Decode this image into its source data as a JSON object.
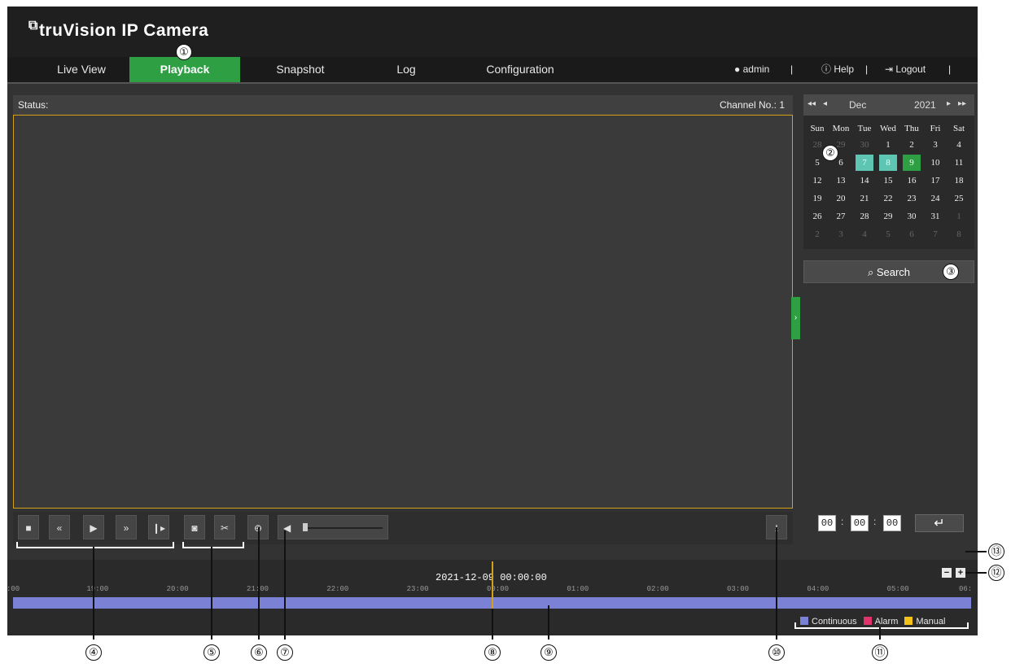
{
  "app": {
    "brand": "truVision",
    "title": "IP Camera",
    "logo_glyph": "⧉"
  },
  "nav": {
    "tabs": [
      "Live View",
      "Playback",
      "Snapshot",
      "Log",
      "Configuration"
    ],
    "active": "Playback",
    "user": "admin",
    "help": "Help",
    "logout": "Logout",
    "sep": "|"
  },
  "player": {
    "status_label": "Status:",
    "channel_label": "Channel No.: 1",
    "volume_level": 0.0
  },
  "calendar": {
    "month": "Dec",
    "year": "2021",
    "days_of_week": [
      "Sun",
      "Mon",
      "Tue",
      "Wed",
      "Thu",
      "Fri",
      "Sat"
    ],
    "weeks": [
      [
        "28",
        "29",
        "30",
        "1",
        "2",
        "3",
        "4"
      ],
      [
        "5",
        "6",
        "7",
        "8",
        "9",
        "10",
        "11"
      ],
      [
        "12",
        "13",
        "14",
        "15",
        "16",
        "17",
        "18"
      ],
      [
        "19",
        "20",
        "21",
        "22",
        "23",
        "24",
        "25"
      ],
      [
        "26",
        "27",
        "28",
        "29",
        "30",
        "31",
        "1"
      ],
      [
        "2",
        "3",
        "4",
        "5",
        "6",
        "7",
        "8"
      ]
    ],
    "recorded_days": [
      "7",
      "8"
    ],
    "selected_day": "9",
    "search_label": "Search"
  },
  "time_input": {
    "hh": "00",
    "mm": "00",
    "ss": "00"
  },
  "timeline": {
    "current": "2021-12-09 00:00:00",
    "ticks": [
      ":00",
      "19:00",
      "20:00",
      "21:00",
      "22:00",
      "23:00",
      "00:00",
      "01:00",
      "02:00",
      "03:00",
      "04:00",
      "05:00",
      "06:"
    ],
    "legend": [
      {
        "label": "Continuous",
        "color": "#7b82d6"
      },
      {
        "label": "Alarm",
        "color": "#e0336b"
      },
      {
        "label": "Manual",
        "color": "#f2c21b"
      }
    ]
  },
  "callouts": [
    "①",
    "②",
    "③",
    "④",
    "⑤",
    "⑥",
    "⑦",
    "⑧",
    "⑨",
    "⑩",
    "⑪",
    "⑫",
    "⑬"
  ],
  "colors": {
    "accent": "#2ea043",
    "video_border": "#d4a017",
    "recorded": "#5fc5b3"
  }
}
